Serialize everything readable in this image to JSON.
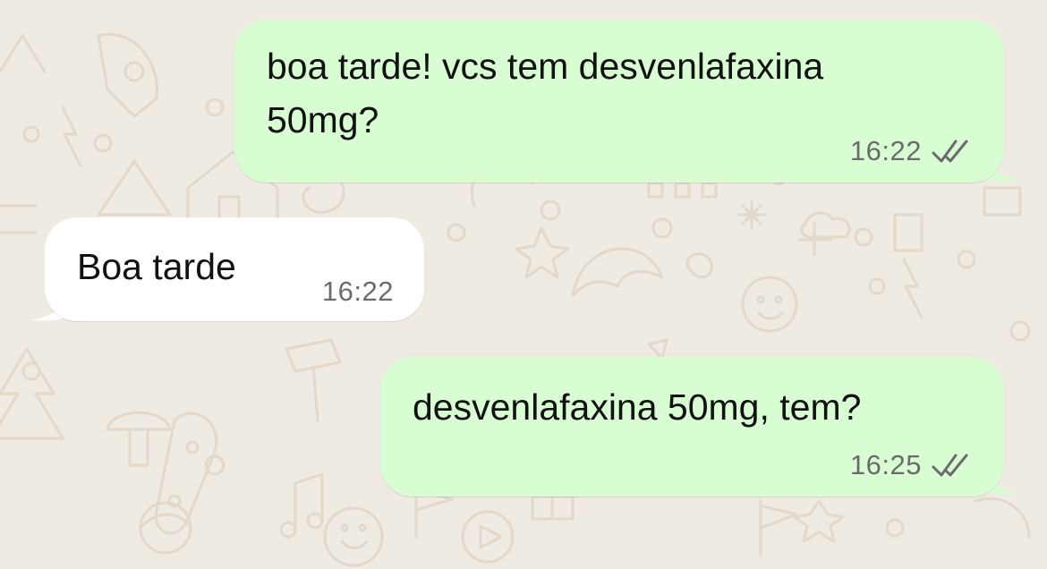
{
  "chat": {
    "messages": [
      {
        "direction": "outgoing",
        "lines": [
          "boa tarde! vcs tem desvenlafaxina",
          "50mg?"
        ],
        "time": "16:22",
        "status_icon": "double-check-icon"
      },
      {
        "direction": "incoming",
        "lines": [
          "Boa tarde"
        ],
        "time": "16:22"
      },
      {
        "direction": "outgoing",
        "lines": [
          "desvenlafaxina 50mg, tem?"
        ],
        "time": "16:25",
        "status_icon": "double-check-icon"
      }
    ]
  },
  "colors": {
    "background": "#efeae2",
    "pattern": "#e2d8cb",
    "outgoing_bubble": "#d9fdd3",
    "incoming_bubble": "#ffffff",
    "time_text": "#6b6b6b",
    "tick_color": "#6b6b6b"
  }
}
